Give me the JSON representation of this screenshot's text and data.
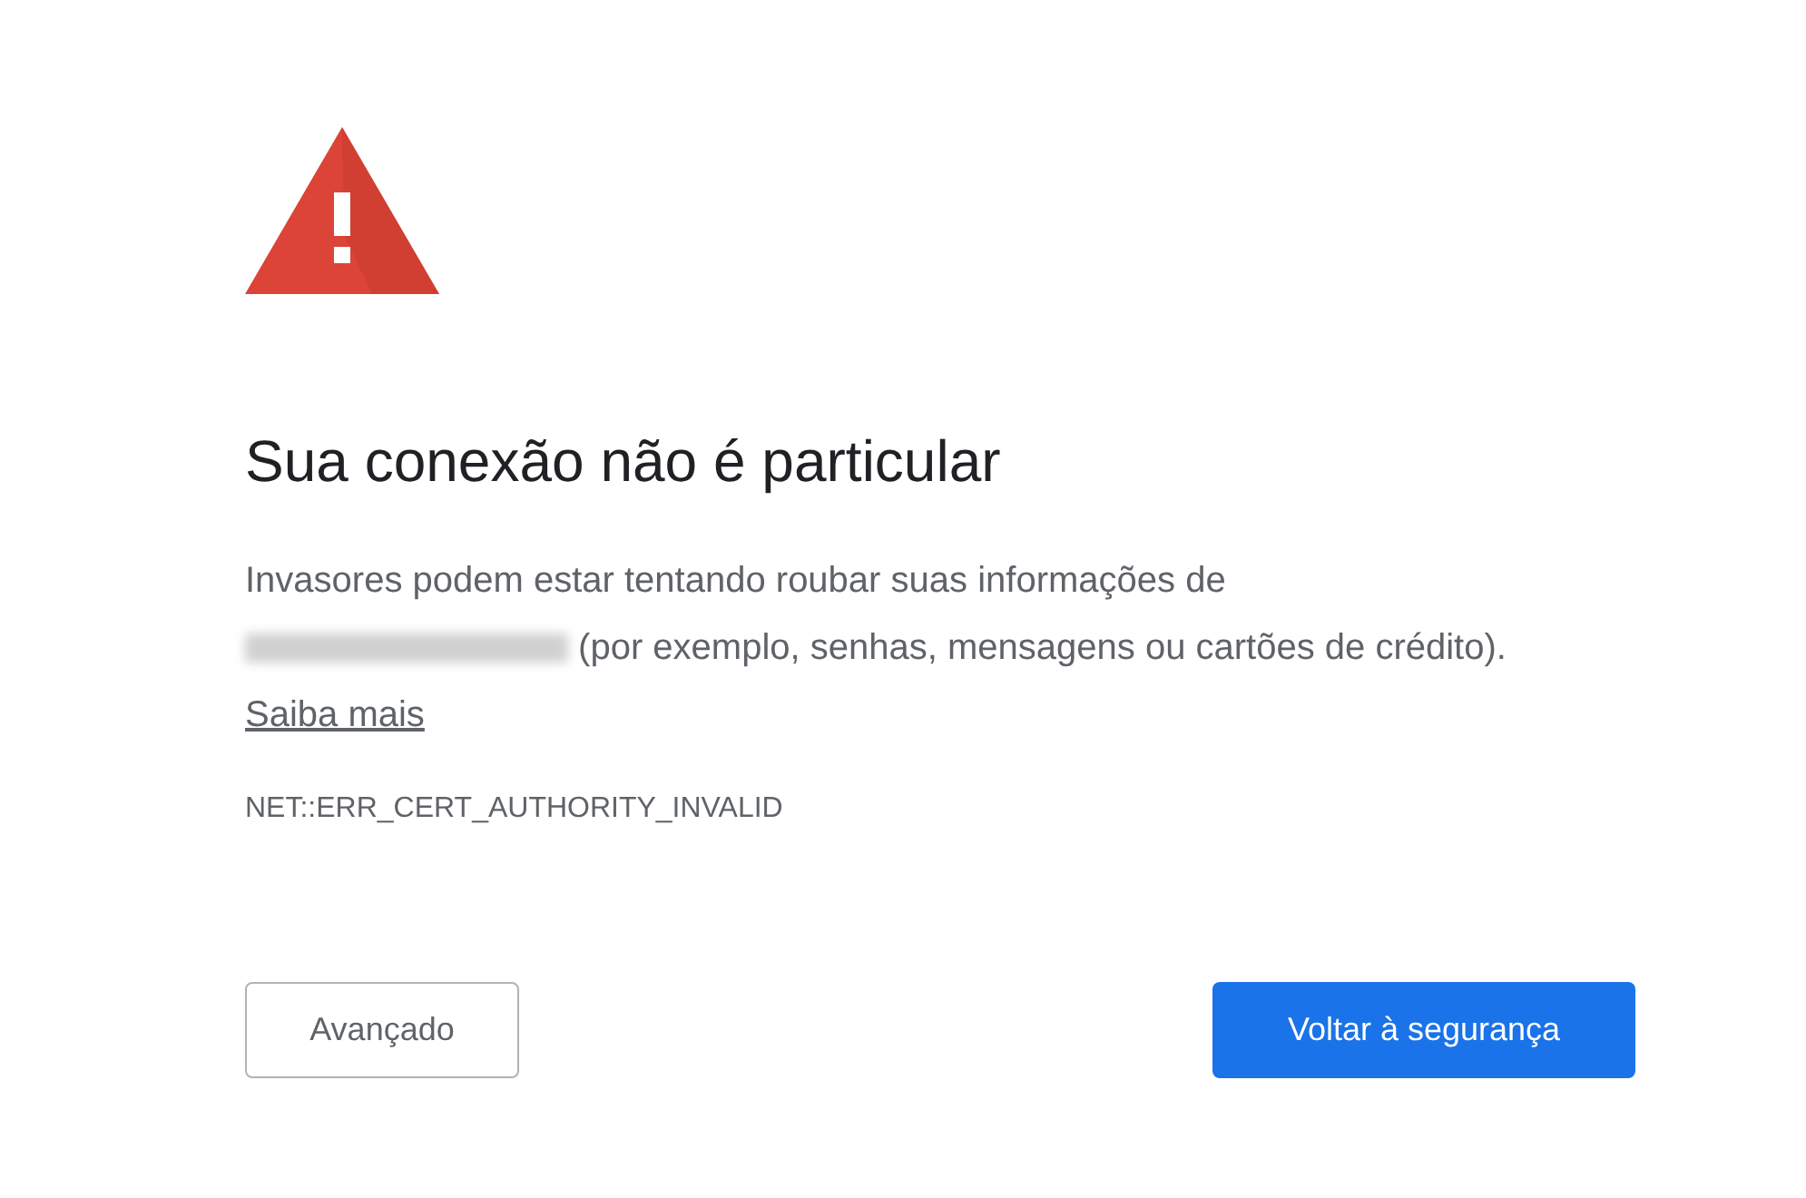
{
  "heading": "Sua conexão não é particular",
  "message": {
    "before": "Invasores podem estar tentando roubar suas informações de",
    "after": "(por exemplo, senhas, mensagens ou cartões de crédito).",
    "link": "Saiba mais"
  },
  "error_code": "NET::ERR_CERT_AUTHORITY_INVALID",
  "buttons": [
    {
      "label": "Avançado",
      "kind": "secondary"
    },
    {
      "label": "Voltar à segurança",
      "kind": "primary"
    }
  ]
}
